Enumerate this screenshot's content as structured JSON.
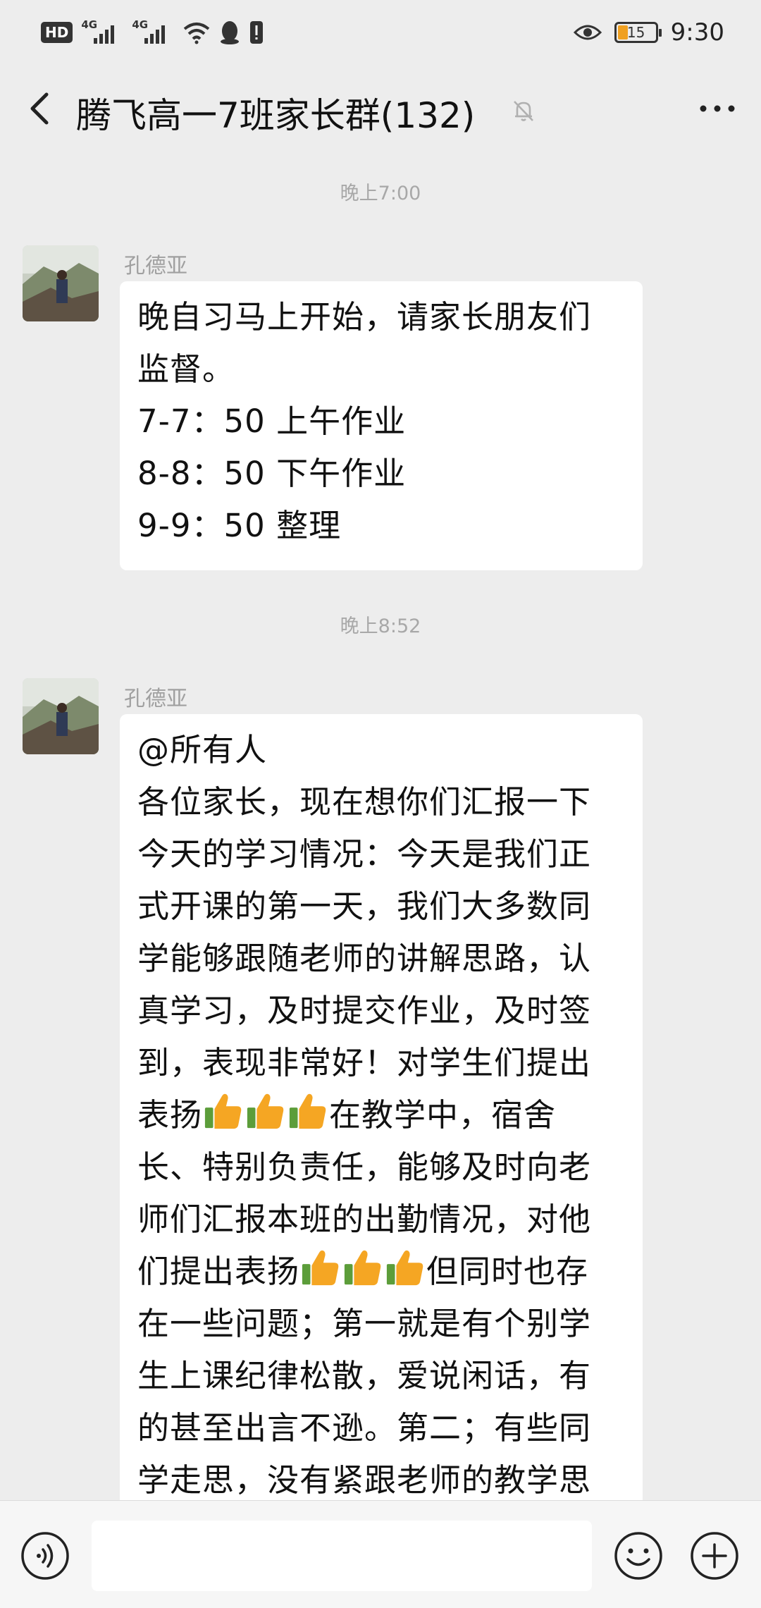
{
  "status_bar": {
    "hd_label": "HD",
    "network_1": "4G",
    "network_2": "4G",
    "battery_level": "15",
    "time": "9:30"
  },
  "header": {
    "title": "腾飞高一7班家长群(132)"
  },
  "messages": [
    {
      "timestamp": "晚上7:00",
      "sender": "孔德亚",
      "lines": [
        "晚自习马上开始，请家长朋友们",
        "监督。",
        "7-7：50 上午作业",
        "8-8：50 下午作业",
        "9-9：50 整理"
      ]
    },
    {
      "timestamp": "晚上8:52",
      "sender": "孔德亚",
      "lines": [
        "@所有人",
        "各位家长，现在想你们汇报一下",
        "今天的学习情况：今天是我们正",
        "式开课的第一天，我们大多数同",
        "学能够跟随老师的讲解思路，认",
        "真学习，及时提交作业，及时签",
        "到，表现非常好！对学生们提出",
        "表扬",
        "在教学中，宿舍",
        "长、特别负责任，能够及时向老",
        "师们汇报本班的出勤情况，对他",
        "们提出表扬",
        "但同时也存",
        "在一些问题；第一就是有个别学",
        "生上课纪律松散，爱说闲话，有",
        "的甚至出言不逊。第二；有些同",
        "学走思，没有紧跟老师的教学思"
      ]
    }
  ],
  "icons": {
    "thumbs_up": "thumbs-up-emoji",
    "back": "chevron-left-icon",
    "mute": "bell-off-icon",
    "more": "more-dots-icon",
    "voice": "voice-icon",
    "emoji": "smiley-icon",
    "plus": "plus-icon"
  },
  "colors": {
    "background": "#ededed",
    "bubble": "#ffffff",
    "timestamp": "#a8a8a8",
    "thumbs_up": "#f5a623"
  }
}
